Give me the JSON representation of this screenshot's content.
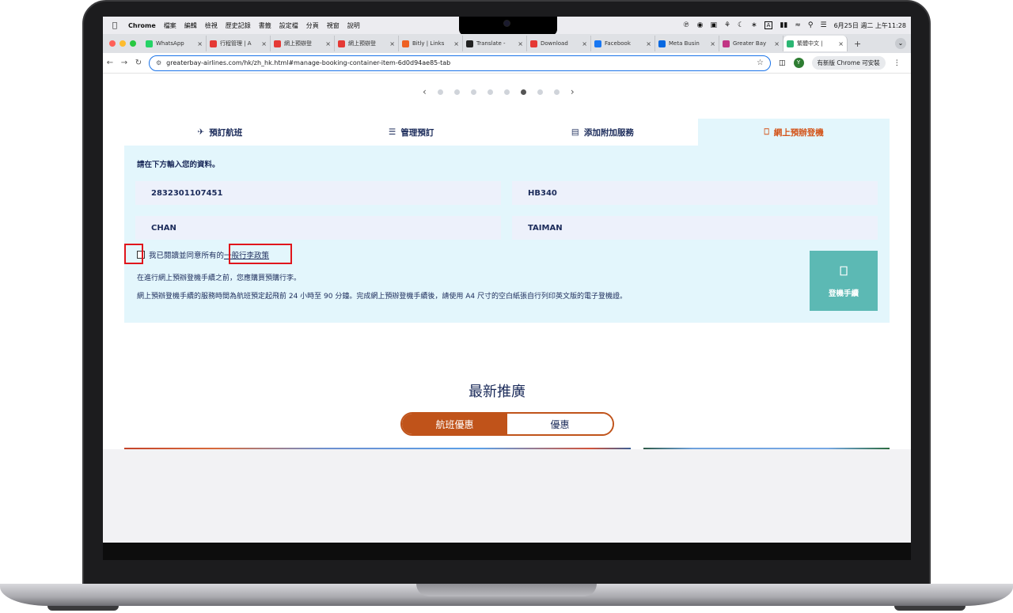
{
  "menubar": {
    "app": "Chrome",
    "items": [
      "檔案",
      "編輯",
      "檢視",
      "歷史記錄",
      "書籤",
      "設定檔",
      "分頁",
      "視窗",
      "說明"
    ],
    "datetime": "6月25日 週二 上午11:28",
    "input_method": "A"
  },
  "browser": {
    "tabs": [
      {
        "title": "WhatsApp",
        "color": "#25d366",
        "icon": "whatsapp-icon"
      },
      {
        "title": "行程管理 | A",
        "color": "#e53935",
        "icon": "airline-icon"
      },
      {
        "title": "網上預辦登",
        "color": "#e53935",
        "icon": "airline-icon"
      },
      {
        "title": "網上預辦登",
        "color": "#e53935",
        "icon": "airline-icon"
      },
      {
        "title": "Bitly | Links",
        "color": "#ee6123",
        "icon": "bitly-icon"
      },
      {
        "title": "Translate -",
        "color": "#222222",
        "icon": "translate-icon"
      },
      {
        "title": "Download",
        "color": "#e53935",
        "icon": "download-icon"
      },
      {
        "title": "Facebook",
        "color": "#1877f2",
        "icon": "facebook-icon"
      },
      {
        "title": "Meta Busin",
        "color": "#0668e1",
        "icon": "meta-icon"
      },
      {
        "title": "Greater Bay",
        "color": "#c13584",
        "icon": "instagram-icon"
      },
      {
        "title": "繁體中文 | ",
        "color": "#2bb673",
        "icon": "greaterbay-icon",
        "active": true
      }
    ],
    "url": "greaterbay-airlines.com/hk/zh_hk.html#manage-booking-container-item-6d0d94ae85-tab",
    "profile_initial": "Y",
    "update_label": "有新版 Chrome 可安裝"
  },
  "carousel": {
    "total_dots": 8,
    "active_index": 5
  },
  "booking_tabs": [
    {
      "label": "預訂航班",
      "icon": "plane-icon",
      "active": false
    },
    {
      "label": "管理預訂",
      "icon": "list-icon",
      "active": false
    },
    {
      "label": "添加附加服務",
      "icon": "luggage-icon",
      "active": false
    },
    {
      "label": "網上預辦登機",
      "icon": "phone-checkin-icon",
      "active": true
    }
  ],
  "checkin": {
    "heading": "請在下方輸入您的資料。",
    "ticket_number": "2832301107451",
    "flight_number": "HB340",
    "last_name": "CHAN",
    "first_name": "TAIMAN",
    "consent_prefix": "我已閱讀並同意所有的",
    "policy_link": "一般行李政策",
    "notice_1": "在進行網上預辦登機手續之前，您應購買預購行李。",
    "notice_2": "網上預辦登機手續的服務時間為航班預定起飛前 24 小時至 90 分鐘。完成網上預辦登機手續後，請使用 A4 尺寸的空白紙張自行列印英文版的電子登機證。",
    "button_label": "登機手續",
    "button_color": "#5cb9b4"
  },
  "promotions": {
    "title": "最新推廣",
    "toggle": [
      "航班優惠",
      "優惠"
    ],
    "accent_color": "#c0531a"
  }
}
